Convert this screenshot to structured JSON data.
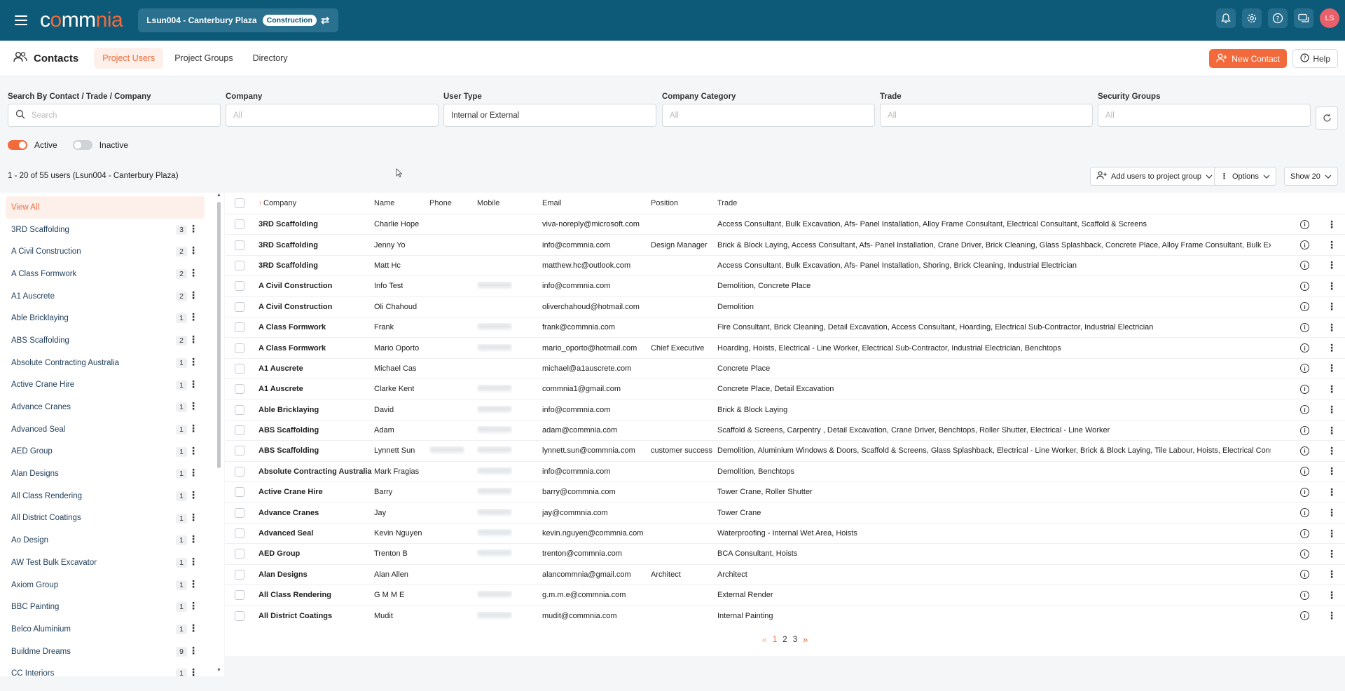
{
  "topbar": {
    "logo_prefix": "c",
    "logo_accent": "o",
    "logo_mid": "mm",
    "logo_accent2": "nia",
    "project_name": "Lsun004 - Canterbury Plaza",
    "project_stage": "Construction",
    "icons": [
      "bell-icon",
      "gear-icon",
      "question-icon",
      "chat-icon"
    ],
    "avatar_initials": "LS"
  },
  "header": {
    "title": "Contacts",
    "tabs": [
      {
        "label": "Project Users",
        "active": true
      },
      {
        "label": "Project Groups",
        "active": false
      },
      {
        "label": "Directory",
        "active": false
      }
    ],
    "new_contact_label": "New Contact",
    "help_label": "Help"
  },
  "filters": {
    "search_label": "Search By Contact / Trade / Company",
    "search_placeholder": "Search",
    "company_label": "Company",
    "company_value": "All",
    "user_type_label": "User Type",
    "user_type_value": "Internal or External",
    "category_label": "Company Category",
    "category_value": "All",
    "trade_label": "Trade",
    "trade_value": "All",
    "security_label": "Security Groups",
    "security_value": "All",
    "active_label": "Active",
    "inactive_label": "Inactive"
  },
  "results": {
    "count_text": "1 - 20 of 55 users (Lsun004 - Canterbury Plaza)",
    "add_users_label": "Add users to project group",
    "options_label": "Options",
    "show_label": "Show 20"
  },
  "sidebar": {
    "items": [
      {
        "label": "View All",
        "count": ""
      },
      {
        "label": "3RD Scaffolding",
        "count": "3"
      },
      {
        "label": "A Civil Construction",
        "count": "2"
      },
      {
        "label": "A Class Formwork",
        "count": "2"
      },
      {
        "label": "A1 Auscrete",
        "count": "2"
      },
      {
        "label": "Able Bricklaying",
        "count": "1"
      },
      {
        "label": "ABS Scaffolding",
        "count": "2"
      },
      {
        "label": "Absolute Contracting Australia",
        "count": "1"
      },
      {
        "label": "Active Crane Hire",
        "count": "1"
      },
      {
        "label": "Advance Cranes",
        "count": "1"
      },
      {
        "label": "Advanced Seal",
        "count": "1"
      },
      {
        "label": "AED Group",
        "count": "1"
      },
      {
        "label": "Alan Designs",
        "count": "1"
      },
      {
        "label": "All Class Rendering",
        "count": "1"
      },
      {
        "label": "All District Coatings",
        "count": "1"
      },
      {
        "label": "Ao Design",
        "count": "1"
      },
      {
        "label": "AW Test Bulk Excavator",
        "count": "1"
      },
      {
        "label": "Axiom Group",
        "count": "1"
      },
      {
        "label": "BBC Painting",
        "count": "1"
      },
      {
        "label": "Belco Aluminium",
        "count": "1"
      },
      {
        "label": "Buildme Dreams",
        "count": "9"
      },
      {
        "label": "CC Interiors",
        "count": "1"
      }
    ]
  },
  "table": {
    "columns": {
      "company": "Company",
      "name": "Name",
      "phone": "Phone",
      "mobile": "Mobile",
      "email": "Email",
      "position": "Position",
      "trade": "Trade"
    },
    "rows": [
      {
        "company": "3RD Scaffolding",
        "name": "Charlie Hope",
        "email": "viva-noreply@microsoft.com",
        "position": "",
        "trade": "Access Consultant, Bulk Excavation, Afs- Panel Installation, Alloy Frame Consultant, Electrical Consultant, Scaffold & Screens",
        "mobile_blur": false,
        "phone_blur": false
      },
      {
        "company": "3RD Scaffolding",
        "name": "Jenny Yo",
        "email": "info@commnia.com",
        "position": "Design Manager",
        "trade": "Brick & Block Laying, Access Consultant, Afs- Panel Installation, Crane Driver, Brick Cleaning, Glass Splashback, Concrete Place, Alloy Frame Consultant, Bulk Excavation",
        "mobile_blur": false,
        "phone_blur": false
      },
      {
        "company": "3RD Scaffolding",
        "name": "Matt Hc",
        "email": "matthew.hc@outlook.com",
        "position": "",
        "trade": "Access Consultant, Bulk Excavation, Afs- Panel Installation, Shoring, Brick Cleaning, Industrial Electrician",
        "mobile_blur": false,
        "phone_blur": false
      },
      {
        "company": "A Civil Construction",
        "name": "Info Test",
        "email": "info@commnia.com",
        "position": "",
        "trade": "Demolition, Concrete Place",
        "mobile_blur": true,
        "phone_blur": false
      },
      {
        "company": "A Civil Construction",
        "name": "Oli Chahoud",
        "email": "oliverchahoud@hotmail.com",
        "position": "",
        "trade": "Demolition",
        "mobile_blur": false,
        "phone_blur": false
      },
      {
        "company": "A Class Formwork",
        "name": "Frank",
        "email": "frank@commnia.com",
        "position": "",
        "trade": "Fire Consultant, Brick Cleaning, Detail Excavation, Access Consultant, Hoarding, Electrical Sub-Contractor, Industrial Electrician",
        "mobile_blur": true,
        "phone_blur": false
      },
      {
        "company": "A Class Formwork",
        "name": "Mario Oporto",
        "email": "mario_oporto@hotmail.com",
        "position": "Chief Executive",
        "trade": "Hoarding, Hoists, Electrical - Line Worker, Electrical Sub-Contractor, Industrial Electrician, Benchtops",
        "mobile_blur": true,
        "phone_blur": false
      },
      {
        "company": "A1 Auscrete",
        "name": "Michael Cas",
        "email": "michael@a1auscrete.com",
        "position": "",
        "trade": "Concrete Place",
        "mobile_blur": false,
        "phone_blur": false
      },
      {
        "company": "A1 Auscrete",
        "name": "Clarke Kent",
        "email": "commnia1@gmail.com",
        "position": "",
        "trade": "Concrete Place, Detail Excavation",
        "mobile_blur": true,
        "phone_blur": false
      },
      {
        "company": "Able Bricklaying",
        "name": "David",
        "email": "info@commnia.com",
        "position": "",
        "trade": "Brick & Block Laying",
        "mobile_blur": true,
        "phone_blur": false
      },
      {
        "company": "ABS Scaffolding",
        "name": "Adam",
        "email": "adam@commnia.com",
        "position": "",
        "trade": "Scaffold & Screens, Carpentry , Detail Excavation, Crane Driver, Benchtops, Roller Shutter, Electrical - Line Worker",
        "mobile_blur": true,
        "phone_blur": false
      },
      {
        "company": "ABS Scaffolding",
        "name": "Lynnett Sun",
        "email": "lynnett.sun@commnia.com",
        "position": "customer success",
        "trade": "Demolition, Aluminium Windows & Doors, Scaffold & Screens, Glass Splashback, Electrical - Line Worker, Brick & Block Laying, Tile Labour, Hoists, Electrical Consultant",
        "mobile_blur": true,
        "phone_blur": true
      },
      {
        "company": "Absolute Contracting Australia",
        "name": "Mark Fragias",
        "email": "info@commnia.com",
        "position": "",
        "trade": "Demolition, Benchtops",
        "mobile_blur": true,
        "phone_blur": false
      },
      {
        "company": "Active Crane Hire",
        "name": "Barry",
        "email": "barry@commnia.com",
        "position": "",
        "trade": "Tower Crane, Roller Shutter",
        "mobile_blur": true,
        "phone_blur": false
      },
      {
        "company": "Advance Cranes",
        "name": "Jay",
        "email": "jay@commnia.com",
        "position": "",
        "trade": "Tower Crane",
        "mobile_blur": true,
        "phone_blur": false
      },
      {
        "company": "Advanced Seal",
        "name": "Kevin Nguyen",
        "email": "kevin.nguyen@commnia.com",
        "position": "",
        "trade": "Waterproofing - Internal Wet Area, Hoists",
        "mobile_blur": true,
        "phone_blur": false
      },
      {
        "company": "AED Group",
        "name": "Trenton B",
        "email": "trenton@commnia.com",
        "position": "",
        "trade": "BCA Consultant, Hoists",
        "mobile_blur": true,
        "phone_blur": false
      },
      {
        "company": "Alan Designs",
        "name": "Alan Allen",
        "email": "alancommnia@gmail.com",
        "position": "Architect",
        "trade": "Architect",
        "mobile_blur": false,
        "phone_blur": false
      },
      {
        "company": "All Class Rendering",
        "name": "G M M E",
        "email": "g.m.m.e@commnia.com",
        "position": "",
        "trade": "External Render",
        "mobile_blur": true,
        "phone_blur": false
      },
      {
        "company": "All District Coatings",
        "name": "Mudit",
        "email": "mudit@commnia.com",
        "position": "",
        "trade": "Internal Painting",
        "mobile_blur": true,
        "phone_blur": false
      }
    ]
  },
  "pagination": {
    "prev": "«",
    "pages": [
      "1",
      "2",
      "3"
    ],
    "current": "1",
    "next": "»"
  }
}
